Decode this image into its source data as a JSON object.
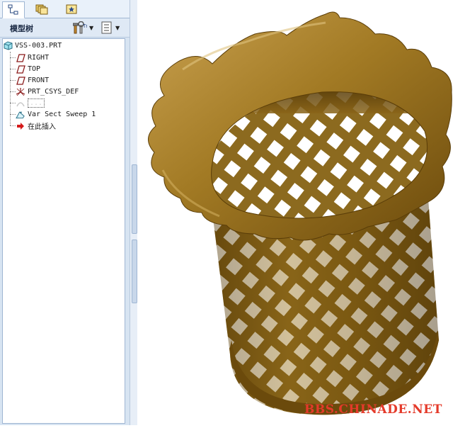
{
  "tabs": [
    {
      "name": "model-tree",
      "icon": "tree-icon"
    },
    {
      "name": "folder-browser",
      "icon": "folders-icon"
    },
    {
      "name": "favorites",
      "icon": "favorites-icon"
    }
  ],
  "panel": {
    "title": "模型树",
    "settings_icon": "settings-tools-icon",
    "show_icon": "show-list-icon"
  },
  "tree": {
    "root": "VSS-003.PRT",
    "items": [
      {
        "label": "RIGHT",
        "icon": "datum-plane-icon"
      },
      {
        "label": "TOP",
        "icon": "datum-plane-icon"
      },
      {
        "label": "FRONT",
        "icon": "datum-plane-icon"
      },
      {
        "label": "PRT_CSYS_DEF",
        "icon": "csys-icon"
      },
      {
        "label": "...",
        "icon": "pattern-icon"
      },
      {
        "label": "Var Sect Sweep 1",
        "icon": "sweep-icon"
      },
      {
        "label": "在此插入",
        "icon": "insert-arrow-icon"
      }
    ]
  },
  "viewport": {
    "model": "wavy-rim-mesh-basket",
    "model_color": "#8a6414",
    "watermark": "BBS.CHINADE.NET",
    "watermark_color": "#e43a2a"
  }
}
